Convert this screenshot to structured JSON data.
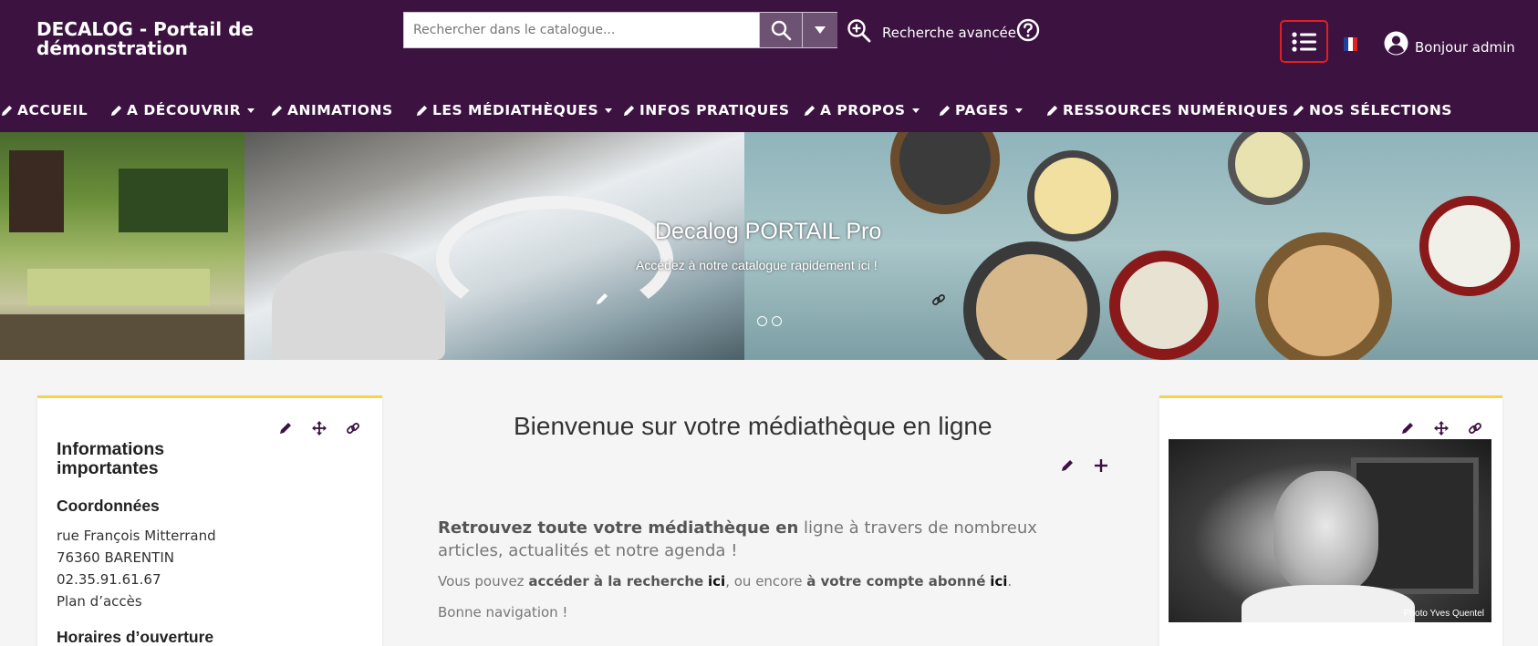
{
  "header": {
    "site_title": "DECALOG - Portail de démonstration",
    "search_placeholder": "Rechercher dans le catalogue...",
    "advanced_search_label": "Recherche avancée",
    "greeting": "Bonjour admin",
    "language": "fr",
    "brand_color": "#3b1240",
    "accent_color": "#6e5273"
  },
  "nav": {
    "items": [
      {
        "label": "ACCUEIL",
        "has_caret": false
      },
      {
        "label": "A DÉCOUVRIR",
        "has_caret": true
      },
      {
        "label": "ANIMATIONS",
        "has_caret": false
      },
      {
        "label": "LES MÉDIATHÈQUES",
        "has_caret": true
      },
      {
        "label": "INFOS PRATIQUES",
        "has_caret": false
      },
      {
        "label": "A PROPOS",
        "has_caret": true
      },
      {
        "label": "PAGES",
        "has_caret": true
      },
      {
        "label": "RESSOURCES NUMÉRIQUES",
        "has_caret": false
      },
      {
        "label": "NOS SÉLECTIONS",
        "has_caret": false
      }
    ]
  },
  "banner": {
    "title": "Decalog PORTAIL Pro",
    "subtitle": "Accédez à notre catalogue rapidement ici !",
    "slide_count": 2
  },
  "left_card": {
    "title": "Informations importantes",
    "contact_heading": "Coordonnées",
    "address_lines": [
      "rue François Mitterrand",
      "76360 BARENTIN",
      "02.35.91.61.67",
      "Plan d’accès"
    ],
    "hours_heading": "Horaires d’ouverture",
    "accent_color": "#f4d44d"
  },
  "main": {
    "welcome": "Bienvenue sur votre médiathèque en ligne",
    "lead_bold": "Retrouvez toute votre médiathèque en",
    "lead_rest": " ligne à travers de nombreux articles, actualités et notre agenda !",
    "p1_a": "Vous pouvez ",
    "p1_b": "accéder à la recherche",
    "p1_c": "ici",
    "p1_d": ", ou encore ",
    "p1_e": "à votre compte abonné",
    "p1_f": "ici",
    "p1_g": ".",
    "p2": "Bonne navigation !"
  },
  "right_card": {
    "photo_credit": "Photo Yves Quentel"
  }
}
